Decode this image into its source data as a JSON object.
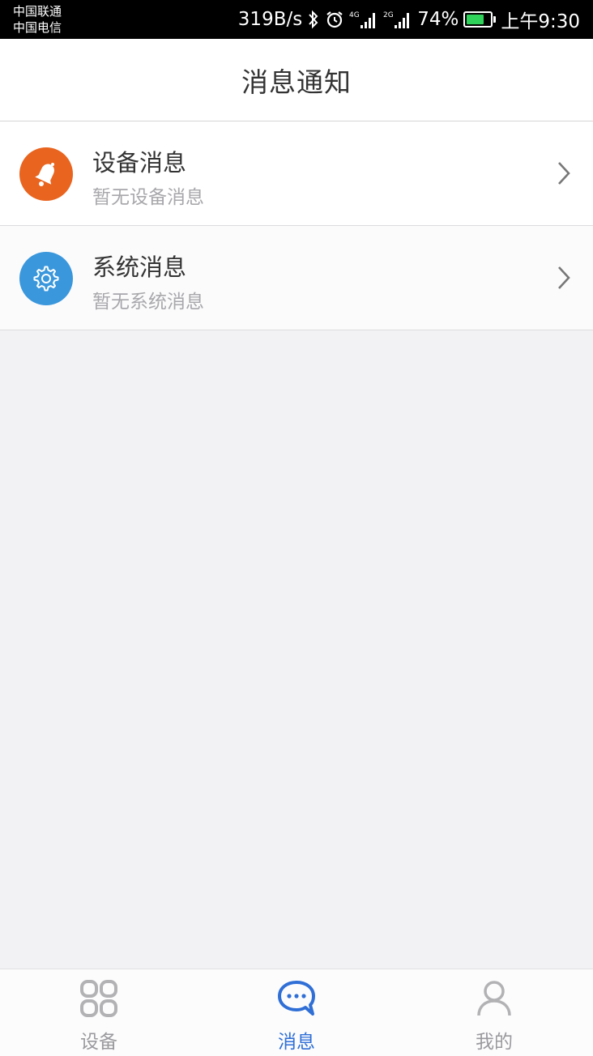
{
  "status_bar": {
    "carrier_1": "中国联通",
    "carrier_2": "中国电信",
    "net_speed": "319B/s",
    "signal_1_label": "4G",
    "signal_2_label": "2G",
    "battery": "74%",
    "battery_level": 0.74,
    "time": "上午9:30"
  },
  "header": {
    "title": "消息通知"
  },
  "messages": [
    {
      "title": "设备消息",
      "subtitle": "暂无设备消息",
      "icon": "bell-icon",
      "color": "#e8641f"
    },
    {
      "title": "系统消息",
      "subtitle": "暂无系统消息",
      "icon": "gear-icon",
      "color": "#3a97dc"
    }
  ],
  "nav": {
    "items": [
      {
        "label": "设备",
        "icon": "devices-icon",
        "active": false
      },
      {
        "label": "消息",
        "icon": "chat-icon",
        "active": true
      },
      {
        "label": "我的",
        "icon": "profile-icon",
        "active": false
      }
    ],
    "active_color": "#2f6fd6",
    "inactive_color": "#9a9a9e"
  }
}
